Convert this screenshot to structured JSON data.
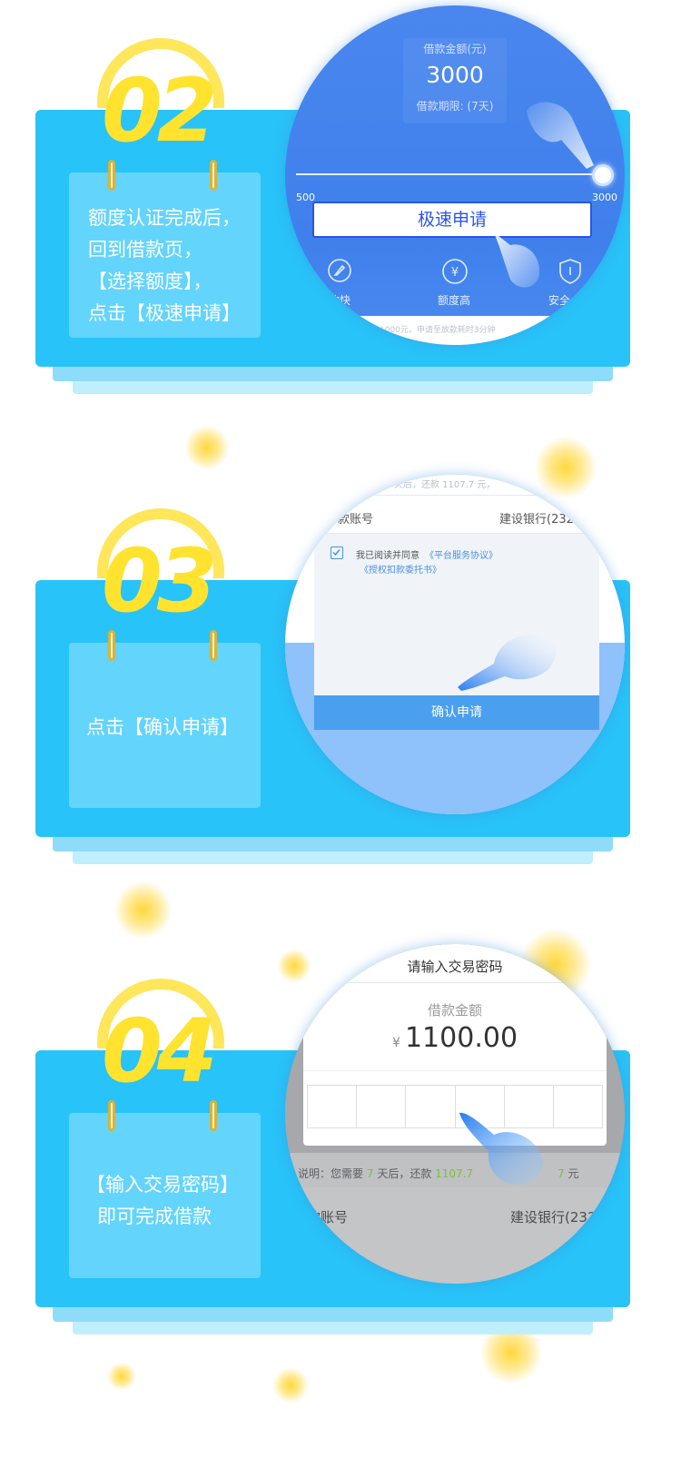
{
  "steps": [
    {
      "number": "02",
      "lines": [
        "额度认证完成后，",
        "回到借款页，",
        "【选择额度】，",
        "点击【极速申请】"
      ],
      "phone": {
        "amount_label": "借款金额(元)",
        "amount_value": "3000",
        "period_label": "借款期限: (7天)",
        "slider_min": "500",
        "slider_max": "3000",
        "slider_level": 1.0,
        "apply_button": "极速申请",
        "features": [
          {
            "icon": "rocket-icon",
            "label": "放款快"
          },
          {
            "icon": "yen-icon",
            "label": "额度高"
          },
          {
            "icon": "shield-icon",
            "label": "安全"
          }
        ],
        "footnote": "1000元，申请至放款耗时3分钟"
      }
    },
    {
      "number": "03",
      "lines": [
        "点击【确认申请】"
      ],
      "phone": {
        "top_strip": "天后，还款 1107.7 元，",
        "account_label": "款账号",
        "bank_text": "建设银行(232",
        "agree_text": "我已阅读并同意",
        "link1": "《平台服务协议》",
        "link2": "《授权扣款委托书》",
        "confirm_button": "确认申请"
      }
    },
    {
      "number": "04",
      "lines": [
        "【输入交易密码】",
        "即可完成借款"
      ],
      "phone": {
        "dialog_title": "请输入交易密码",
        "amount_label": "借款金额",
        "currency": "¥",
        "amount_value": "1100.00",
        "note_prefix": "说明：您需要",
        "note_days": "7",
        "note_mid": "天后，还款",
        "note_amount": "1107.7",
        "note_tail_num": "7",
        "note_unit": "元",
        "account_label": "款账号",
        "bank_text": "建设银行(232"
      }
    }
  ],
  "colors": {
    "card": "#28c3f8",
    "note": "#63d4fc",
    "number": "#ffe32f",
    "button_blue": "#2a55e8",
    "confirm_bar": "#4aa0ee"
  }
}
